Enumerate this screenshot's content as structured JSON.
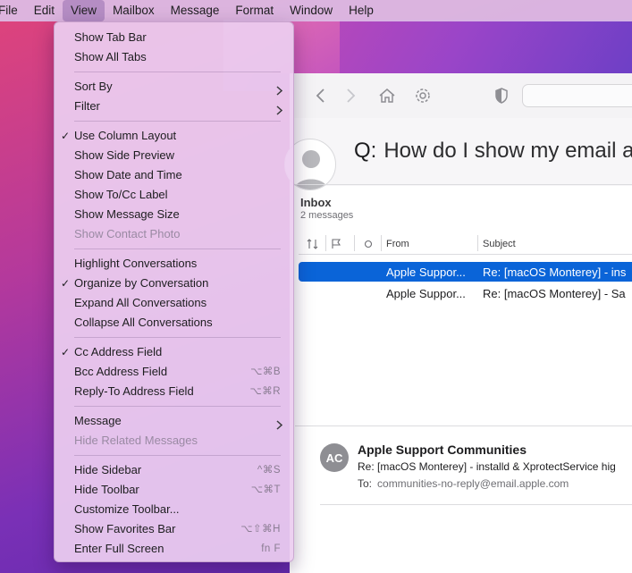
{
  "menubar": {
    "items": [
      "File",
      "Edit",
      "View",
      "Mailbox",
      "Message",
      "Format",
      "Window",
      "Help"
    ],
    "active": "View"
  },
  "menu": {
    "groups": [
      [
        {
          "label": "Show Tab Bar"
        },
        {
          "label": "Show All Tabs"
        }
      ],
      [
        {
          "label": "Sort By",
          "submenu": true
        },
        {
          "label": "Filter",
          "submenu": true
        }
      ],
      [
        {
          "label": "Use Column Layout",
          "checked": true
        },
        {
          "label": "Show Side Preview"
        },
        {
          "label": "Show Date and Time"
        },
        {
          "label": "Show To/Cc Label"
        },
        {
          "label": "Show Message Size"
        },
        {
          "label": "Show Contact Photo",
          "disabled": true
        }
      ],
      [
        {
          "label": "Highlight Conversations"
        },
        {
          "label": "Organize by Conversation",
          "checked": true
        },
        {
          "label": "Expand All Conversations"
        },
        {
          "label": "Collapse All Conversations"
        }
      ],
      [
        {
          "label": "Cc Address Field",
          "checked": true
        },
        {
          "label": "Bcc Address Field",
          "shortcut": "⌥⌘B"
        },
        {
          "label": "Reply-To Address Field",
          "shortcut": "⌥⌘R"
        }
      ],
      [
        {
          "label": "Message",
          "submenu": true
        },
        {
          "label": "Hide Related Messages",
          "disabled": true
        }
      ],
      [
        {
          "label": "Hide Sidebar",
          "shortcut": "^⌘S"
        },
        {
          "label": "Hide Toolbar",
          "shortcut": "⌥⌘T"
        },
        {
          "label": "Customize Toolbar..."
        },
        {
          "label": "Show Favorites Bar",
          "shortcut": "⌥⇧⌘H"
        },
        {
          "label": "Enter Full Screen",
          "shortcut": "fn F"
        }
      ]
    ]
  },
  "thread": {
    "question_prefix": "Q:",
    "title": "How do I show my email as"
  },
  "mailbox": {
    "title": "Inbox",
    "count": "2 messages",
    "columns": {
      "from": "From",
      "subject": "Subject"
    },
    "messages": [
      {
        "from": "Apple Suppor...",
        "subject": "Re: [macOS Monterey] - ins",
        "selected": true
      },
      {
        "from": "Apple Suppor...",
        "subject": "Re: [macOS Monterey] - Sa",
        "selected": false
      }
    ]
  },
  "detail": {
    "avatar_initials": "AC",
    "sender": "Apple Support Communities",
    "subject": "Re: [macOS Monterey] - installd & XprotectService hig",
    "to_label": "To:",
    "to_address": "communities-no-reply@email.apple.com"
  },
  "colors": {
    "selection": "#0a64d8",
    "menu_background": "#ecceF0"
  }
}
